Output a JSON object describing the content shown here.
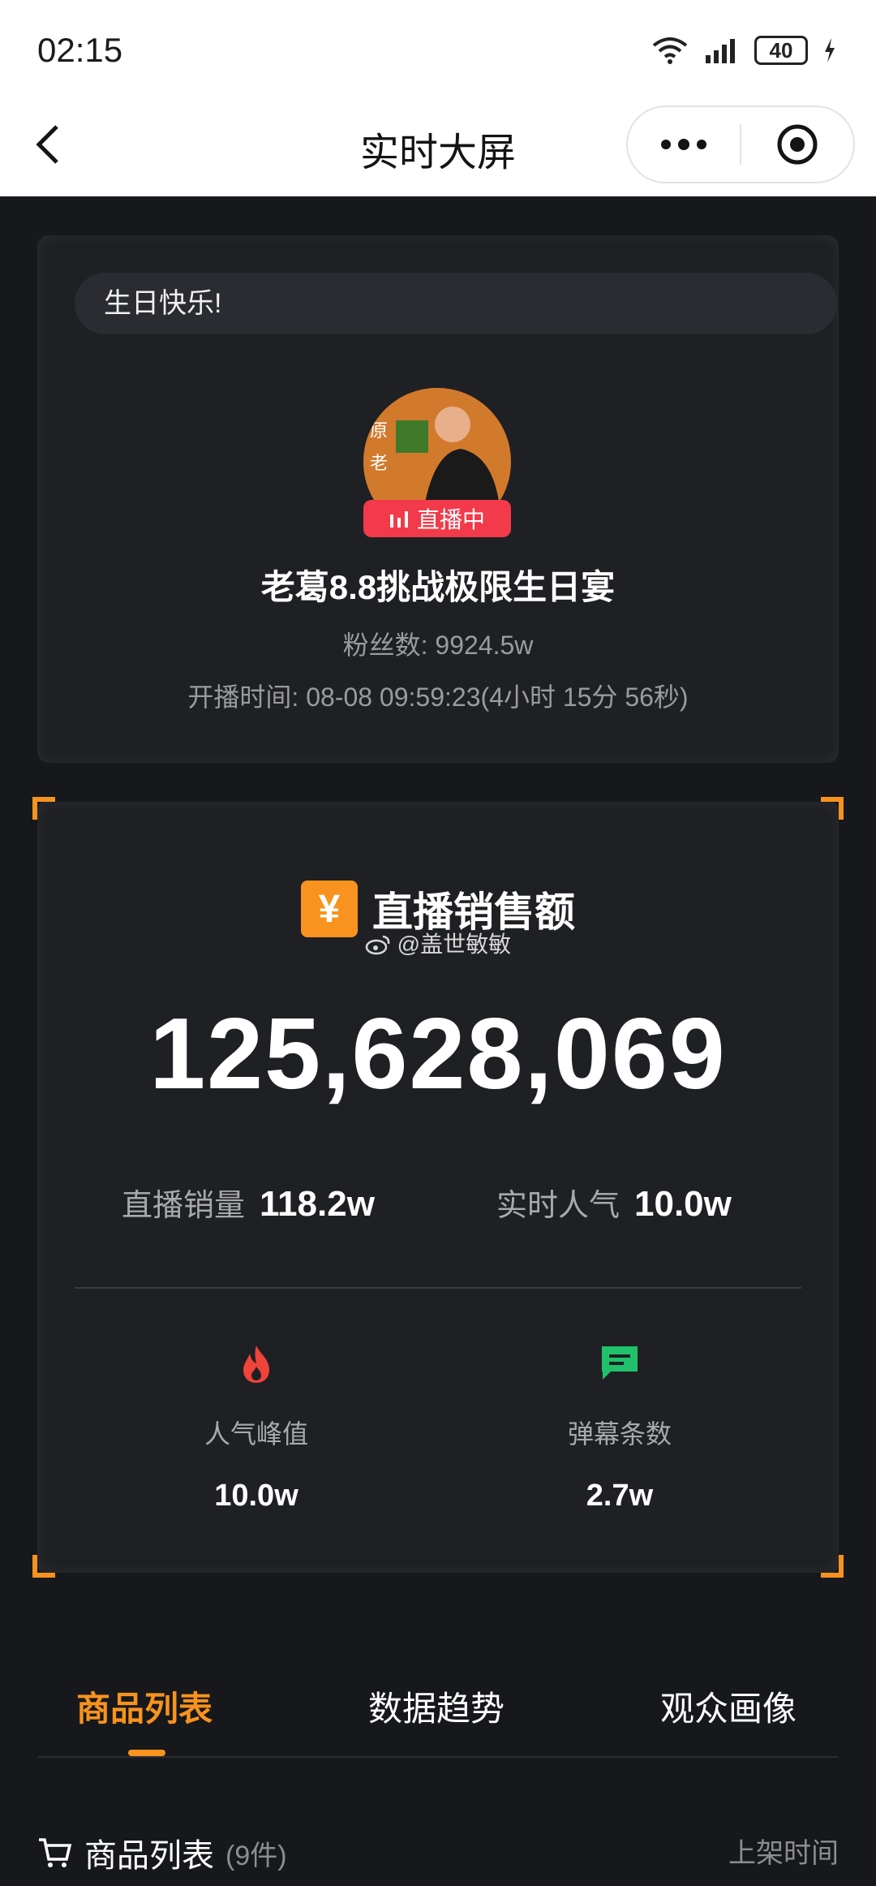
{
  "status_bar": {
    "time": "02:15",
    "battery": "40"
  },
  "nav": {
    "title": "实时大屏"
  },
  "streamer": {
    "notice": "生日快乐!",
    "live_badge": "直播中",
    "room_title": "老葛8.8挑战极限生日宴",
    "fans": "粉丝数:  9924.5w",
    "start_time": "开播时间:  08-08 09:59:23(4小时 15分 56秒)",
    "avatar_text": "原 老"
  },
  "sales": {
    "label": "直播销售额",
    "watermark": "@盖世敏敏",
    "total": "125,628,069",
    "volume_label": "直播销量",
    "volume_value": "118.2w",
    "popularity_label": "实时人气",
    "popularity_value": "10.0w",
    "peak_label": "人气峰值",
    "peak_value": "10.0w",
    "danmaku_label": "弹幕条数",
    "danmaku_value": "2.7w"
  },
  "tabs": [
    "商品列表",
    "数据趋势",
    "观众画像"
  ],
  "product_list": {
    "title": "商品列表",
    "count": "(9件)",
    "sort_label": "上架时间"
  },
  "colors": {
    "accent": "#f7931e",
    "live": "#f23a4a",
    "chat": "#1fc26b",
    "fire": "#f0433a"
  }
}
